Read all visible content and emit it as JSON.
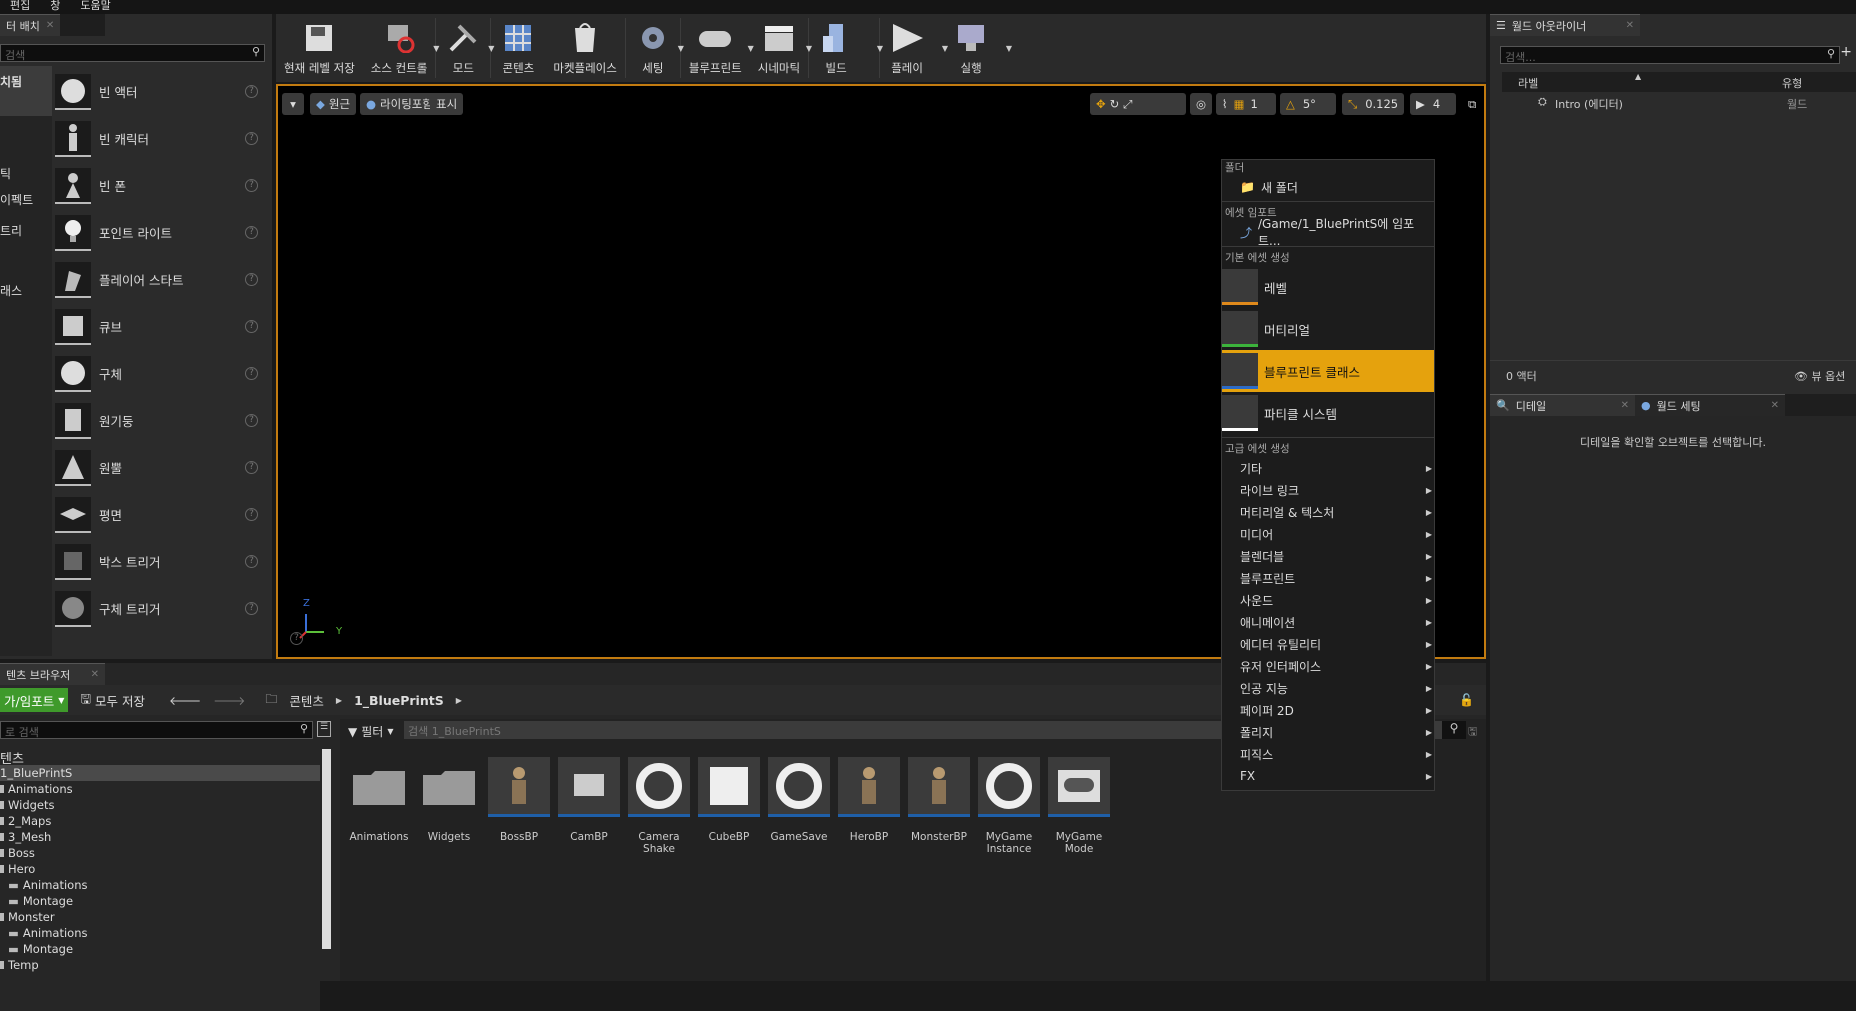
{
  "menu": [
    "편집",
    "창",
    "도움말"
  ],
  "place": {
    "tab": "터 배치",
    "search_placeholder": "검색",
    "categories": [
      "치됨",
      "틱",
      "이펙트",
      "트리",
      "래스"
    ],
    "items": [
      "빈 액터",
      "빈 캐릭터",
      "빈 폰",
      "포인트 라이트",
      "플레이어 스타트",
      "큐브",
      "구체",
      "원기둥",
      "원뿔",
      "평면",
      "박스 트리거",
      "구체 트리거"
    ]
  },
  "toolbar": [
    "현재 레벨 저장",
    "소스 컨트롤",
    "모드",
    "콘텐츠",
    "마켓플레이스",
    "세팅",
    "블루프린트",
    "시네마틱",
    "빌드",
    "플레이",
    "실행"
  ],
  "viewport": {
    "perspective": "원근",
    "lighting": "라이팅포함",
    "show": "표시",
    "angle": "5°",
    "scale": "0.125",
    "speed": "4",
    "axis_y": "Y",
    "axis_z": "Z"
  },
  "context_menu": {
    "folder_header": "폴더",
    "new_folder": "새 폴더",
    "import_header": "에셋 임포트",
    "import_item": "/Game/1_BluePrintS에 임포트...",
    "basic_header": "기본 에셋 생성",
    "basic": [
      "레벨",
      "머티리얼",
      "블루프린트 클래스",
      "파티클 시스템"
    ],
    "selected": "블루프린트 클래스",
    "advanced_header": "고급 에셋 생성",
    "advanced": [
      "기타",
      "라이브 링크",
      "머티리얼 & 텍스처",
      "미디어",
      "블렌더블",
      "블루프린트",
      "사운드",
      "애니메이션",
      "에디터 유틸리티",
      "유저 인터페이스",
      "인공 지능",
      "페이퍼 2D",
      "폴리지",
      "피직스",
      "FX"
    ]
  },
  "outliner": {
    "tab": "월드 아웃라이너",
    "search_placeholder": "검색...",
    "col_label": "라벨",
    "col_type": "유형",
    "row_label": "Intro (에디터)",
    "row_type": "월드",
    "count": "0 액터",
    "view_options": "뷰 옵션"
  },
  "details": {
    "tab1": "디테일",
    "tab2": "월드 세팅",
    "empty_msg": "디테일을 확인할 오브젝트를 선택합니다."
  },
  "content_browser": {
    "tab": "텐츠 브라우저",
    "add_import": "가/임포트",
    "save_all": "모두 저장",
    "path_root": "콘텐츠",
    "path_current": "1_BluePrintS",
    "tree_search": "로 검색",
    "filter": "필터",
    "search_placeholder": "검색 1_BluePrintS",
    "tree": [
      {
        "label": "텐츠",
        "indent": 0,
        "type": "header"
      },
      {
        "label": "1_BluePrintS",
        "indent": 0,
        "type": "sel"
      },
      {
        "label": "Animations",
        "indent": 0,
        "type": "f"
      },
      {
        "label": "Widgets",
        "indent": 0,
        "type": "f"
      },
      {
        "label": "2_Maps",
        "indent": 0,
        "type": "f"
      },
      {
        "label": "3_Mesh",
        "indent": 0,
        "type": "f"
      },
      {
        "label": "Boss",
        "indent": 0,
        "type": "f"
      },
      {
        "label": "Hero",
        "indent": 0,
        "type": "f"
      },
      {
        "label": "Animations",
        "indent": 1,
        "type": "f"
      },
      {
        "label": "Montage",
        "indent": 1,
        "type": "f"
      },
      {
        "label": "Monster",
        "indent": 0,
        "type": "f"
      },
      {
        "label": "Animations",
        "indent": 1,
        "type": "f"
      },
      {
        "label": "Montage",
        "indent": 1,
        "type": "f"
      },
      {
        "label": "Temp",
        "indent": 0,
        "type": "f"
      }
    ],
    "assets": [
      "Animations",
      "Widgets",
      "BossBP",
      "CamBP",
      "Camera Shake",
      "CubeBP",
      "GameSave",
      "HeroBP",
      "MonsterBP",
      "MyGame Instance",
      "MyGame Mode"
    ]
  }
}
